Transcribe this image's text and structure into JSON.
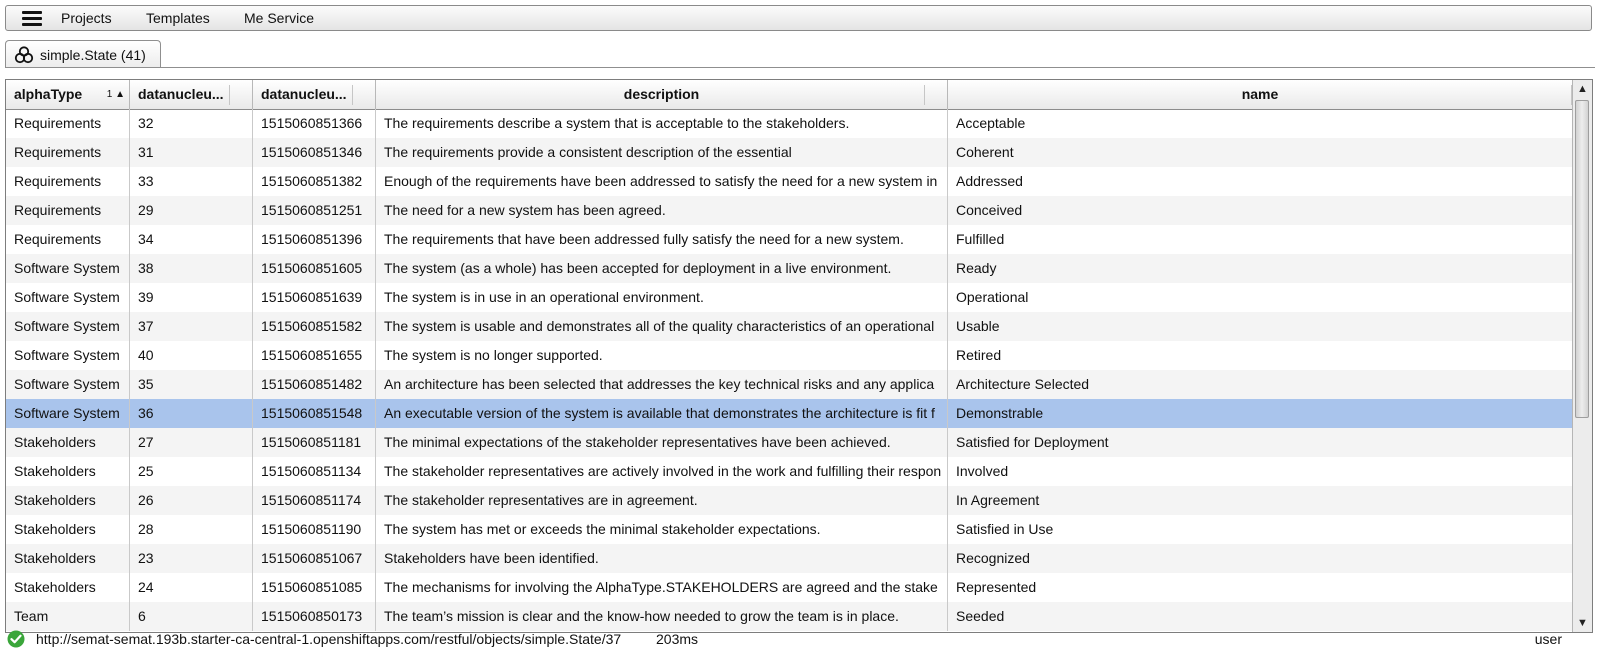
{
  "menubar": {
    "items": [
      {
        "label": "Projects"
      },
      {
        "label": "Templates"
      },
      {
        "label": "Me Service"
      }
    ]
  },
  "tab": {
    "label": "simple.State (41)",
    "icon": "objects-icon"
  },
  "grid": {
    "columns": [
      {
        "label": "alphaType",
        "sort": "1",
        "sort_dir": "▲"
      },
      {
        "label": "datanucleu..."
      },
      {
        "label": "datanucleu..."
      },
      {
        "label": "description"
      },
      {
        "label": "name"
      }
    ],
    "rows": [
      [
        "Requirements",
        "32",
        "1515060851366",
        "The requirements describe a system that is acceptable to the stakeholders.",
        "Acceptable"
      ],
      [
        "Requirements",
        "31",
        "1515060851346",
        "The requirements provide a consistent description of the essential",
        "Coherent"
      ],
      [
        "Requirements",
        "33",
        "1515060851382",
        "Enough of the requirements have been addressed to satisfy the need for a new system in",
        "Addressed"
      ],
      [
        "Requirements",
        "29",
        "1515060851251",
        "The need for a new system has been agreed.",
        "Conceived"
      ],
      [
        "Requirements",
        "34",
        "1515060851396",
        "The requirements that have been addressed fully satisfy the need for a new system.",
        "Fulfilled"
      ],
      [
        "Software System",
        "38",
        "1515060851605",
        "The system (as a whole) has been accepted for deployment in a live environment.",
        "Ready"
      ],
      [
        "Software System",
        "39",
        "1515060851639",
        "The system is in use in an operational environment.",
        "Operational"
      ],
      [
        "Software System",
        "37",
        "1515060851582",
        "The system is usable and demonstrates all of the quality characteristics of an operational",
        "Usable"
      ],
      [
        "Software System",
        "40",
        "1515060851655",
        "The system is no longer supported.",
        "Retired"
      ],
      [
        "Software System",
        "35",
        "1515060851482",
        "An architecture has been selected that addresses the key technical risks and any applica",
        "Architecture Selected"
      ],
      [
        "Software System",
        "36",
        "1515060851548",
        "An executable version of the system is available that demonstrates the architecture is fit f",
        "Demonstrable"
      ],
      [
        "Stakeholders",
        "27",
        "1515060851181",
        "The minimal expectations of the stakeholder representatives have been achieved.",
        "Satisfied for Deployment"
      ],
      [
        "Stakeholders",
        "25",
        "1515060851134",
        "The stakeholder representatives are actively involved in the work and fulfilling their respon",
        "Involved"
      ],
      [
        "Stakeholders",
        "26",
        "1515060851174",
        "The stakeholder representatives are in agreement.",
        "In Agreement"
      ],
      [
        "Stakeholders",
        "28",
        "1515060851190",
        "The system has met or exceeds the minimal stakeholder expectations.",
        "Satisfied in Use"
      ],
      [
        "Stakeholders",
        "23",
        "1515060851067",
        "Stakeholders have been identified.",
        "Recognized"
      ],
      [
        "Stakeholders",
        "24",
        "1515060851085",
        "The mechanisms for involving the AlphaType.STAKEHOLDERS are agreed and the stake",
        "Represented"
      ],
      [
        "Team",
        "6",
        "1515060850173",
        "The team’s mission is clear and the know-how needed to grow the team is in place.",
        "Seeded"
      ]
    ],
    "selected_row": 10
  },
  "status": {
    "url": "http://semat-semat.193b.starter-ca-central-1.openshiftapps.com/restful/objects/simple.State/37",
    "time": "203ms",
    "user": "user",
    "icon": "success-check-icon"
  },
  "colors": {
    "selection": "#a9c4ec",
    "alt_row": "#f4f4f4",
    "ok": "#3aa63a"
  }
}
